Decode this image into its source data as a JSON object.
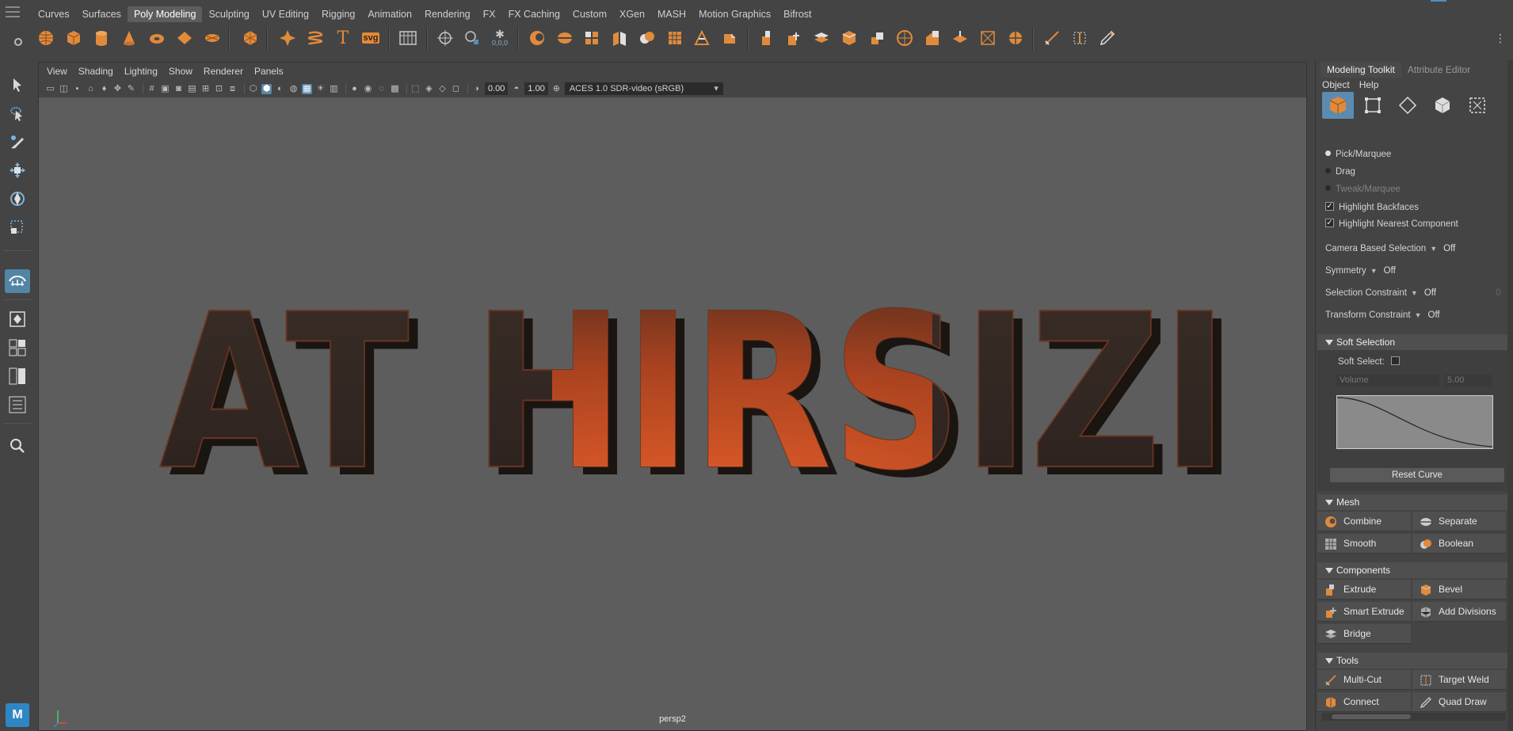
{
  "shelf": {
    "tabs": [
      "Curves",
      "Surfaces",
      "Poly Modeling",
      "Sculpting",
      "UV Editing",
      "Rigging",
      "Animation",
      "Rendering",
      "FX",
      "FX Caching",
      "Custom",
      "XGen",
      "MASH",
      "Motion Graphics",
      "Bifrost"
    ],
    "active_tab": "Poly Modeling",
    "icons": [
      "poly-sphere-icon",
      "poly-cube-icon",
      "poly-cylinder-icon",
      "poly-cone-icon",
      "poly-torus-icon",
      "poly-plane-icon",
      "poly-disc-icon",
      "platonic-icon",
      "super-shape-icon",
      "helix-icon",
      "type-icon",
      "svg-icon",
      "insert-frame-icon",
      "combine-icon",
      "separate-icon",
      "snowflake-icon",
      "mirror-icon",
      "boolean-icon",
      "multi-cut-icon",
      "bevel-icon",
      "bridge-icon",
      "extrude-icon",
      "extrude-face-icon",
      "poke-icon",
      "wedge-icon",
      "duplicate-icon",
      "sculpt-icon",
      "smooth-icon",
      "cage-icon",
      "retopo-icon",
      "crease-icon",
      "slide-icon",
      "knife-icon"
    ],
    "svg_label": "svg",
    "coord_label": "0,0,0"
  },
  "viewport": {
    "menu": [
      "View",
      "Shading",
      "Lighting",
      "Show",
      "Renderer",
      "Panels"
    ],
    "exposure": "0.00",
    "gamma": "1.00",
    "color_space": "ACES 1.0 SDR-video (sRGB)",
    "camera": "persp2",
    "scene_text": "AT HIRSIZI"
  },
  "toolkit": {
    "tabs": [
      "Modeling Toolkit",
      "Attribute Editor"
    ],
    "menu": [
      "Object",
      "Help"
    ],
    "modes": [
      "object-mode-icon",
      "vertex-mode-icon",
      "edge-mode-icon",
      "face-mode-icon",
      "uv-mode-icon"
    ],
    "selection": {
      "pick_marquee": "Pick/Marquee",
      "drag": "Drag",
      "tweak_marquee": "Tweak/Marquee",
      "highlight_backfaces": "Highlight Backfaces",
      "highlight_nearest": "Highlight Nearest Component"
    },
    "options": [
      {
        "label": "Camera Based Selection",
        "value": "Off"
      },
      {
        "label": "Symmetry",
        "value": "Off"
      },
      {
        "label": "Selection Constraint",
        "value": "Off",
        "extra": "0"
      },
      {
        "label": "Transform Constraint",
        "value": "Off"
      }
    ],
    "soft_selection": {
      "title": "Soft Selection",
      "soft_select_label": "Soft Select:",
      "mode": "Volume",
      "radius": "5.00",
      "reset": "Reset Curve"
    },
    "mesh": {
      "title": "Mesh",
      "buttons": [
        "Combine",
        "Separate",
        "Smooth",
        "Boolean"
      ]
    },
    "components": {
      "title": "Components",
      "buttons": [
        "Extrude",
        "Bevel",
        "Smart Extrude",
        "Add Divisions",
        "Bridge"
      ]
    },
    "tools": {
      "title": "Tools",
      "buttons": [
        "Multi-Cut",
        "Target Weld",
        "Connect",
        "Quad Draw"
      ]
    }
  },
  "colors": {
    "accent": "#5b8bb0",
    "icon_orange": "#e08a3c",
    "viewport_bg": "#5d5d5d",
    "text_glow": "#e25a22"
  },
  "maya_badge": "M"
}
